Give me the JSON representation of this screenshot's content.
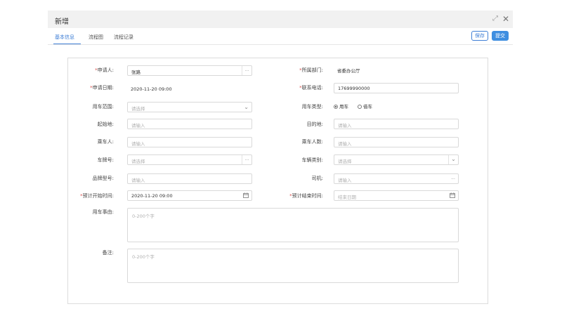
{
  "window": {
    "title": "新增",
    "maximize_icon": "⤢",
    "close_icon": "✕"
  },
  "tabs": [
    "基本信息",
    "流程图",
    "流程记录"
  ],
  "actions": {
    "save_label": "保存",
    "submit_label": "提交"
  },
  "form": {
    "applicant": {
      "label": "申请人:",
      "value": "张路",
      "button": "..."
    },
    "department": {
      "label": "所属部门:",
      "value": "省委办公厅"
    },
    "apply_date": {
      "label": "申请日期:",
      "value": "2020-11-20 09:00"
    },
    "phone": {
      "label": "联系电话:",
      "value": "17699990000"
    },
    "car_scope": {
      "label": "用车范围:",
      "placeholder": "请选择"
    },
    "car_type": {
      "label": "用车类型:",
      "options": [
        "用车",
        "借车"
      ],
      "selected": "用车"
    },
    "origin": {
      "label": "起始地:",
      "placeholder": "请输入"
    },
    "destination": {
      "label": "目的地:",
      "placeholder": "请输入"
    },
    "passenger": {
      "label": "乘车人:",
      "placeholder": "请输入"
    },
    "passenger_count": {
      "label": "乘车人数:",
      "placeholder": "请输入"
    },
    "plate_no": {
      "label": "车牌号:",
      "placeholder": "请选择",
      "button": "..."
    },
    "vehicle_category": {
      "label": "车辆类别:",
      "placeholder": "请选择"
    },
    "brand_model": {
      "label": "品牌型号:",
      "placeholder": "请输入"
    },
    "driver": {
      "label": "司机:",
      "placeholder": "请输入",
      "button": "..."
    },
    "planned_start": {
      "label": "预计开始时间:",
      "value": "2020-11-20 09:00"
    },
    "planned_end": {
      "label": "预计结束时间:",
      "placeholder": "结束日期"
    },
    "reason": {
      "label": "用车事由:",
      "placeholder": "0-200个字"
    },
    "remark": {
      "label": "备注:",
      "placeholder": "0-200个字"
    },
    "required_mark": "*"
  },
  "colors": {
    "accent": "#3f7fd6",
    "required": "#d9534f",
    "border": "#d9d9d9"
  }
}
